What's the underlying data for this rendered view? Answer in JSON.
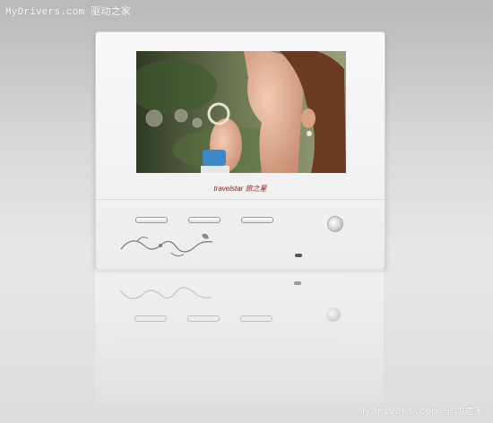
{
  "watermark": {
    "top": "MyDrivers.com 驱动之家",
    "bottom": "MyDrivers.com 驱动之家"
  },
  "device": {
    "brand": "travelstar 旅之星",
    "button_count": 3,
    "power_icon": "power-icon",
    "ornament_icon": "floral-swirl-icon"
  },
  "colors": {
    "body": "#f3f3f3",
    "brand_text": "#8a1818",
    "background": "#d0d0d0"
  }
}
